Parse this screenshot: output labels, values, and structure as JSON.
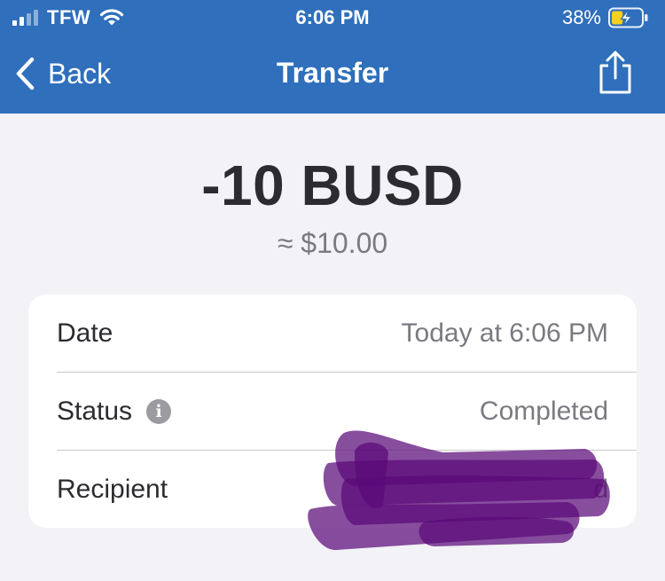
{
  "status_bar": {
    "carrier": "TFW",
    "time": "6:06 PM",
    "battery_percent": "38%",
    "battery_level": 0.38,
    "battery_charging": true
  },
  "nav": {
    "back_label": "Back",
    "title": "Transfer",
    "share_icon": "share-icon"
  },
  "transaction": {
    "amount": "-10 BUSD",
    "fiat_equivalent": "≈ $10.00"
  },
  "details": {
    "date_label": "Date",
    "date_value": "Today at 6:06 PM",
    "status_label": "Status",
    "status_value": "Completed",
    "recipient_label": "Recipient",
    "recipient_value_tail": "d"
  },
  "colors": {
    "header_bg": "#2f6fbb",
    "page_bg": "#f2f2f7",
    "redaction": "#5a0a78"
  }
}
